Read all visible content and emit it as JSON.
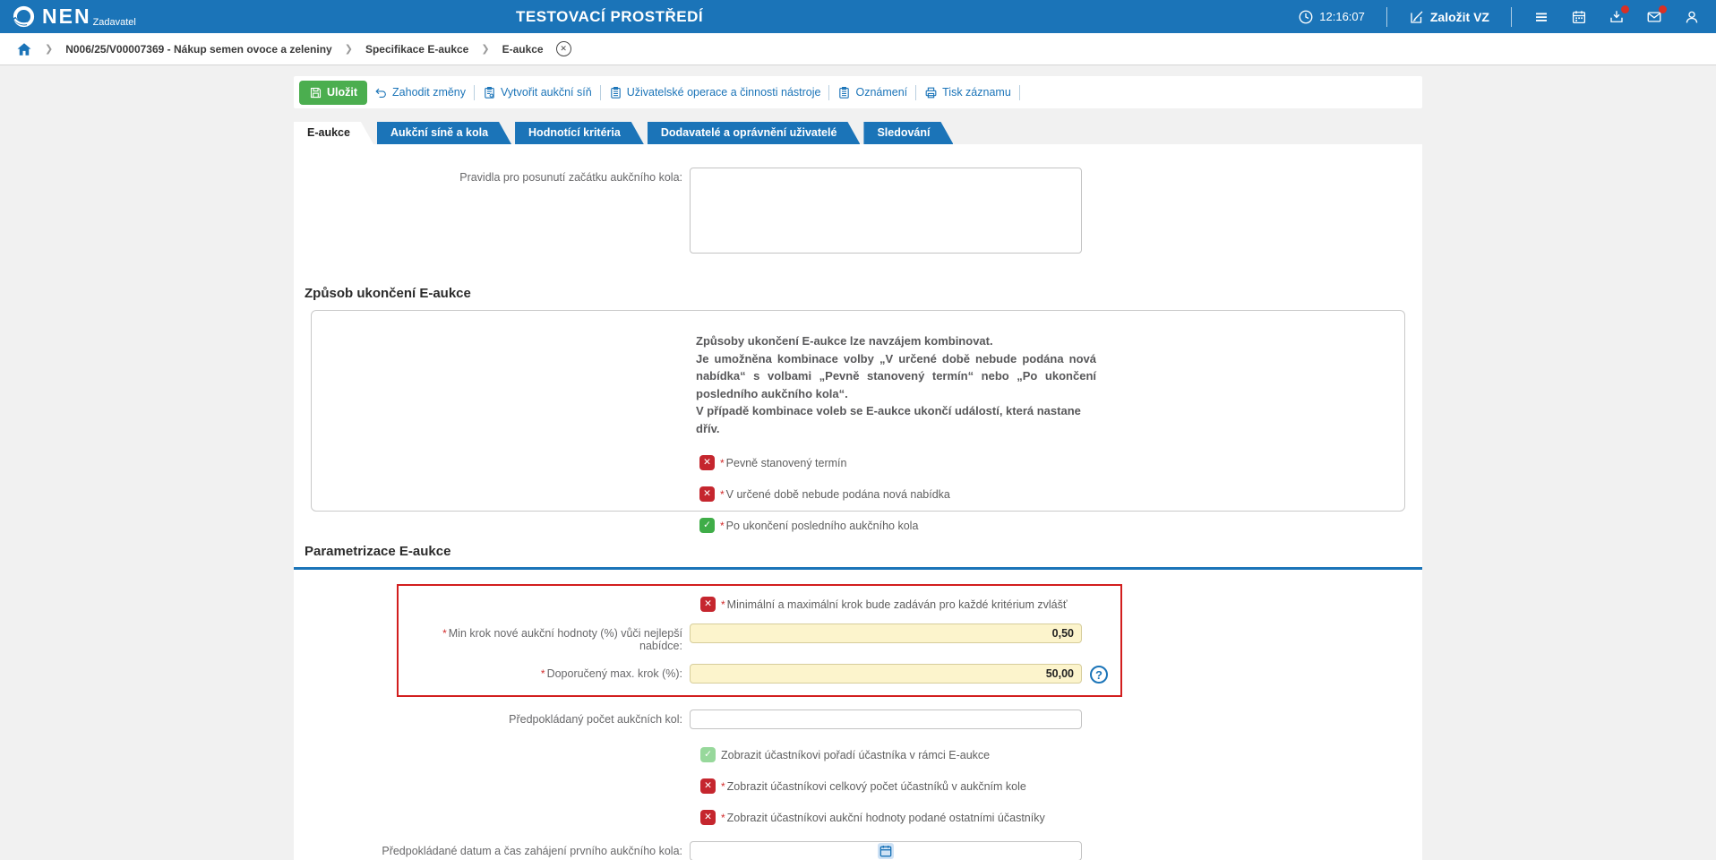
{
  "app": {
    "logo": "NEN",
    "logo_subtitle": "Zadavatel",
    "environment_title": "TESTOVACÍ PROSTŘEDÍ",
    "clock_time": "12:16:07",
    "create_vz_label": "Založit VZ"
  },
  "breadcrumb": {
    "items": [
      "N006/25/V00007369 - Nákup semen ovoce a zeleniny",
      "Specifikace E-aukce",
      "E-aukce"
    ]
  },
  "toolbar": {
    "save": "Uložit",
    "discard": "Zahodit změny",
    "create_room": "Vytvořit aukční síň",
    "user_ops": "Uživatelské operace a činnosti nástroje",
    "notices": "Oznámení",
    "print": "Tisk záznamu"
  },
  "tabs": [
    {
      "label": "E-aukce",
      "active": true
    },
    {
      "label": "Aukční síně a kola",
      "active": false
    },
    {
      "label": "Hodnotící kritéria",
      "active": false
    },
    {
      "label": "Dodavatelé a oprávnění uživatelé",
      "active": false
    },
    {
      "label": "Sledování",
      "active": false
    }
  ],
  "form": {
    "rules_field": {
      "label": "Pravidla pro posunutí začátku aukčního kola:",
      "value": ""
    },
    "ending_section": {
      "heading": "Způsob ukončení E-aukce",
      "info_lines": [
        "Způsoby ukončení E-aukce lze navzájem kombinovat.",
        "Je umožněna kombinace volby „V určené době nebude podána nová nabídka“ s volbami „Pevně stanovený termín“ nebo „Po ukončení posledního aukčního kola“.",
        "V případě kombinace voleb se E-aukce ukončí událostí, která nastane dřív."
      ],
      "options": [
        {
          "label": "Pevně stanovený termín",
          "state": "unchecked",
          "required": true
        },
        {
          "label": "V určené době nebude podána nová nabídka",
          "state": "unchecked",
          "required": true
        },
        {
          "label": "Po ukončení posledního aukčního kola",
          "state": "checked",
          "required": true
        }
      ]
    },
    "parameters_section": {
      "heading": "Parametrizace E-aukce",
      "step_option": {
        "label": "Minimální a maximální krok bude zadáván pro každé kritérium zvlášť",
        "state": "unchecked",
        "required": true
      },
      "min_step": {
        "label": "Min krok nové aukční hodnoty (%) vůči nejlepší nabídce:",
        "value": "0,50",
        "required": true
      },
      "max_step": {
        "label": "Doporučený max. krok (%):",
        "value": "50,00",
        "required": true
      },
      "rounds": {
        "label": "Předpokládaný počet aukčních kol:",
        "value": ""
      },
      "display_options": [
        {
          "label": "Zobrazit účastníkovi pořadí účastníka v rámci E-aukce",
          "state": "checked-disabled",
          "required": false
        },
        {
          "label": "Zobrazit účastníkovi celkový počet účastníků v aukčním kole",
          "state": "unchecked",
          "required": true
        },
        {
          "label": "Zobrazit účastníkovi aukční hodnoty podané ostatními účastníky",
          "state": "unchecked",
          "required": true
        }
      ],
      "start_datetime": {
        "label": "Předpokládané datum a čas zahájení prvního aukčního kola:",
        "value": ""
      }
    }
  },
  "icons": {
    "cross": "✕",
    "check": "✓",
    "chevron": "❯",
    "close": "✕",
    "help": "?",
    "required_mark": "*"
  },
  "colors": {
    "primary_blue": "#1b74b8",
    "save_green": "#4bae4f",
    "unchecked_red": "#c5262e",
    "checked_green": "#3fad48",
    "checked_disabled_green": "#97d89b",
    "field_yellow": "#fcf4cc",
    "highlight_red": "#d21e1e",
    "badge_red": "#d93025"
  }
}
